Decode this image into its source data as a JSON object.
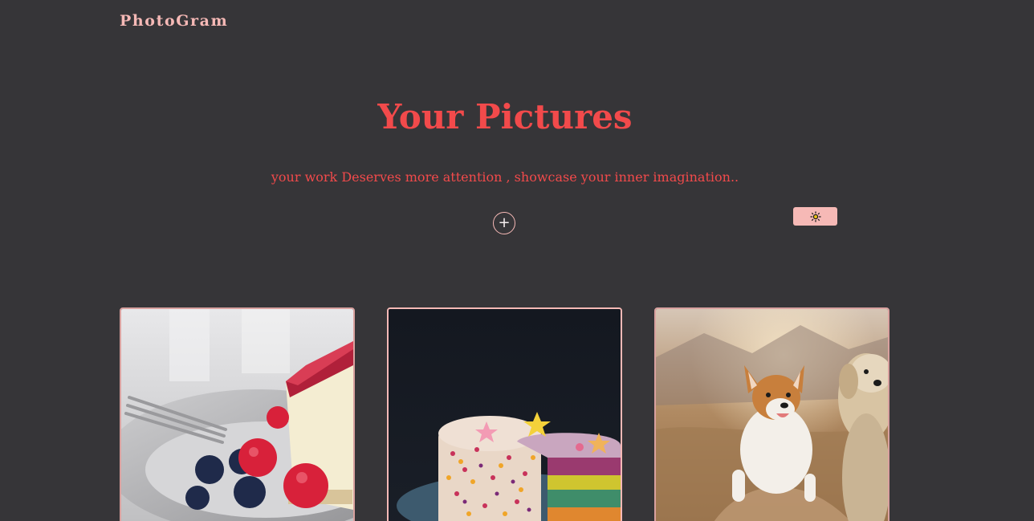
{
  "header": {
    "brand": "PhotoGram"
  },
  "hero": {
    "title": "Your Pictures",
    "subtitle": "your work Deserves more attention , showcase your inner imagination..",
    "add_label": "+"
  },
  "theme_toggle": {
    "icon": "sun-icon"
  },
  "gallery": {
    "items": [
      {
        "subject": "cheesecake-photo"
      },
      {
        "subject": "sprinkle-cake-photo"
      },
      {
        "subject": "dogs-photo"
      }
    ]
  },
  "colors": {
    "background": "#363538",
    "brand": "#f6b9b6",
    "accent": "#f24a4b"
  }
}
